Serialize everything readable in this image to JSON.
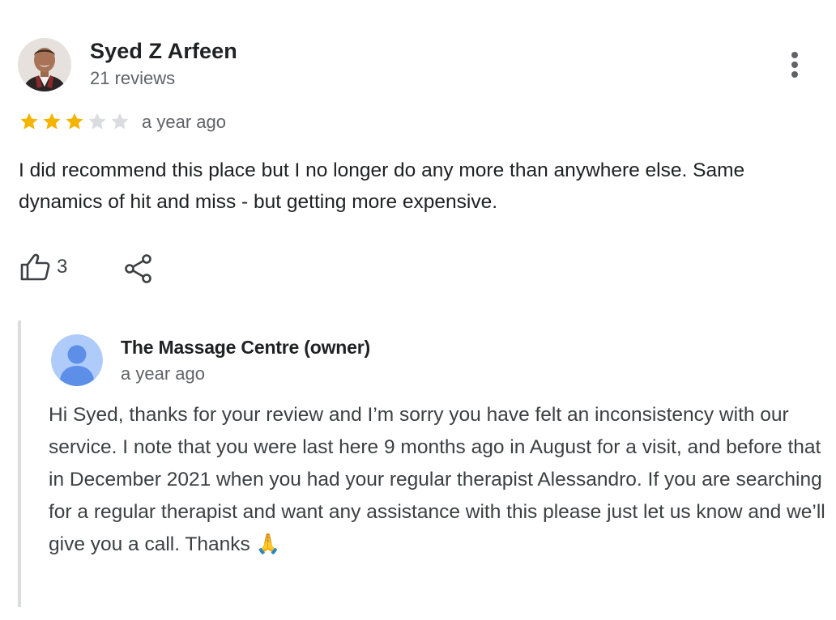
{
  "review": {
    "reviewer": {
      "name": "Syed Z Arfeen",
      "reviews_count": "21 reviews"
    },
    "rating": {
      "value": 3,
      "max": 5
    },
    "date": "a year ago",
    "text": "I did recommend this place but I no longer do any more than anywhere else. Same dynamics of hit and miss - but getting more expensive.",
    "likes": "3",
    "icons": {
      "more": "more-vert-icon",
      "like": "thumbs-up-icon",
      "share": "share-icon",
      "star": "star-icon"
    },
    "colors": {
      "star_filled": "#f4b400",
      "star_empty": "#dadce0",
      "owner_avatar_bg": "#aecbfa",
      "owner_avatar_fg": "#5e8fe8",
      "reply_border": "#dadce0"
    }
  },
  "reply": {
    "owner_name": "The Massage Centre (owner)",
    "date": "a year ago",
    "text": "Hi Syed, thanks for your review and I’m sorry you have felt an inconsistency with our service. I note that you were last here 9 months ago in August for a visit, and before that in December 2021 when you had your regular therapist Alessandro. If you are searching for a regular therapist and want any assistance with this please just let us know and we’ll give you a call. Thanks 🙏"
  }
}
